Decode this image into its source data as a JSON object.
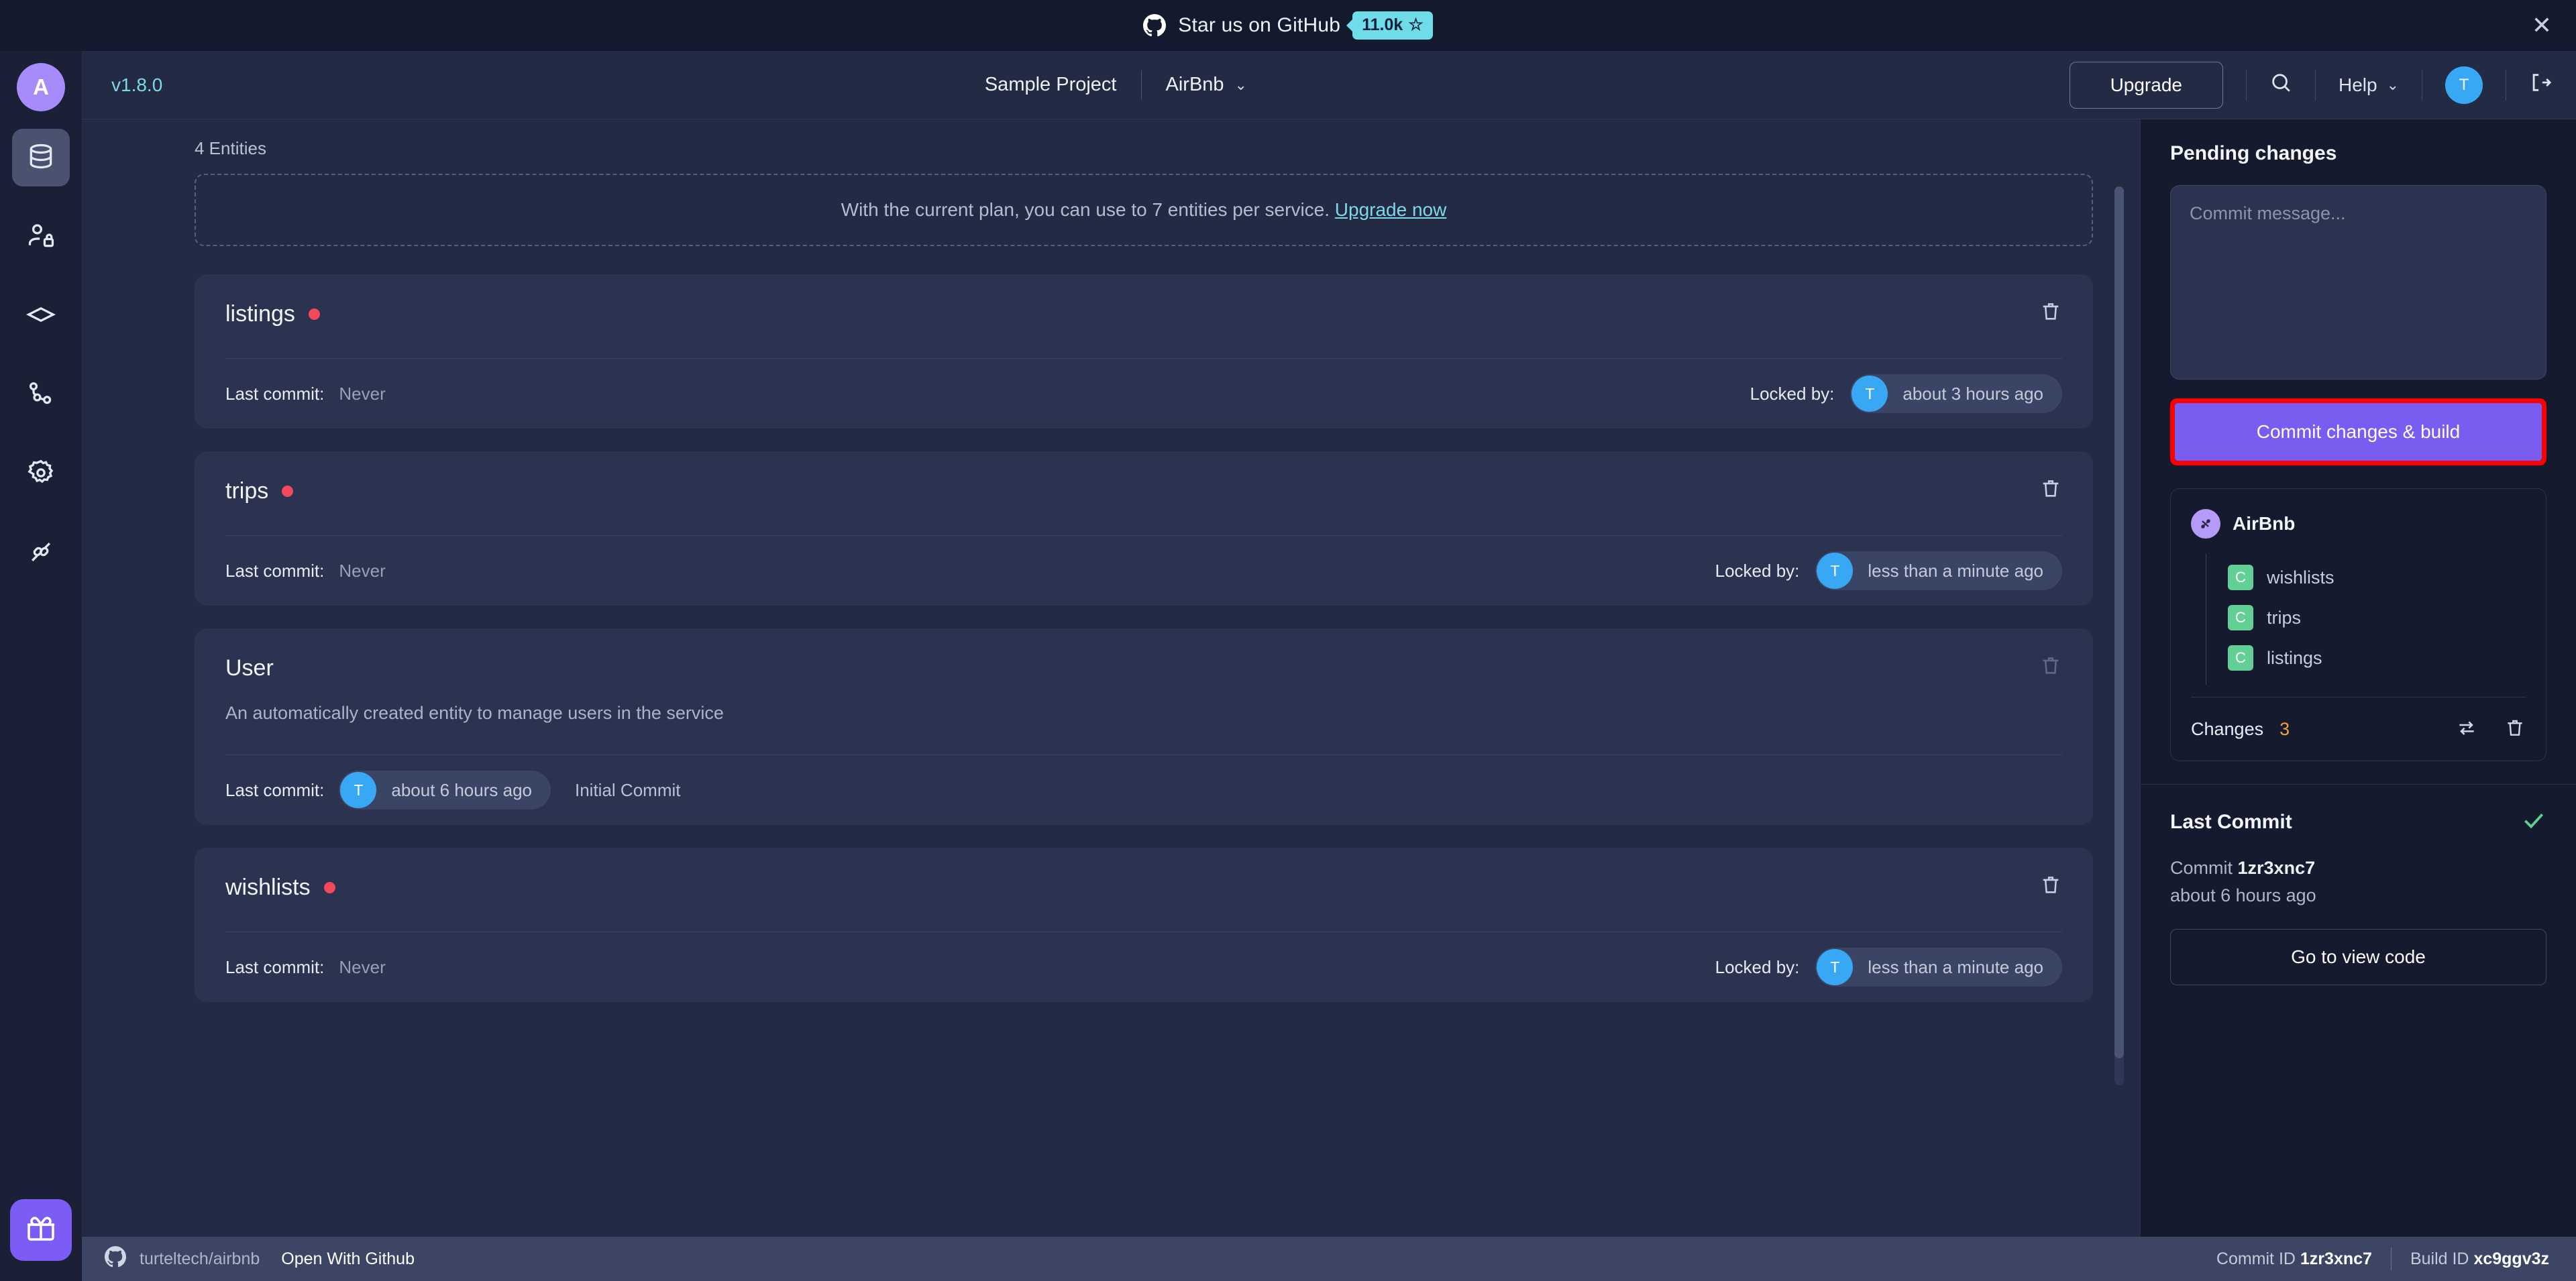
{
  "promo": {
    "icon": "github-icon",
    "text": "Star us on GitHub",
    "badge_count": "11.0k",
    "badge_star": "☆",
    "close": "✕"
  },
  "header": {
    "version": "v1.8.0",
    "project": "Sample Project",
    "service": "AirBnb",
    "service_chevron": "⌄",
    "upgrade_label": "Upgrade",
    "search_icon": "search-icon",
    "help_label": "Help",
    "help_chevron": "⌄",
    "avatar_initial": "T",
    "logout_icon": "logout-icon"
  },
  "rail": {
    "avatar_initial": "A",
    "items": [
      {
        "name": "database-icon",
        "active": true
      },
      {
        "name": "user-lock-icon",
        "active": false
      },
      {
        "name": "diamond-icon",
        "active": false
      },
      {
        "name": "git-branch-icon",
        "active": false
      },
      {
        "name": "settings-gear-icon",
        "active": false
      },
      {
        "name": "plugin-icon",
        "active": false
      }
    ],
    "gift_icon": "gift-icon"
  },
  "main": {
    "entity_count_label": "4 Entities",
    "quota_text": "With the current plan, you can use to 7 entities per service.",
    "quota_link": "Upgrade now",
    "entities": [
      {
        "name": "listings",
        "has_dot": true,
        "description": "",
        "last_commit_label": "Last commit:",
        "last_commit_value": "Never",
        "locked_label": "Locked by:",
        "locked_avatar": "T",
        "locked_time": "about 3 hours ago",
        "extra": "",
        "trash_enabled": true
      },
      {
        "name": "trips",
        "has_dot": true,
        "description": "",
        "last_commit_label": "Last commit:",
        "last_commit_value": "Never",
        "locked_label": "Locked by:",
        "locked_avatar": "T",
        "locked_time": "less than a minute ago",
        "extra": "",
        "trash_enabled": true
      },
      {
        "name": "User",
        "has_dot": false,
        "description": "An automatically created entity to manage users in the service",
        "last_commit_label": "Last commit:",
        "last_commit_value": "",
        "commit_avatar": "T",
        "commit_time": "about 6 hours ago",
        "extra": "Initial Commit",
        "locked_label": "",
        "locked_avatar": "",
        "locked_time": "",
        "trash_enabled": false
      },
      {
        "name": "wishlists",
        "has_dot": true,
        "description": "",
        "last_commit_label": "Last commit:",
        "last_commit_value": "Never",
        "locked_label": "Locked by:",
        "locked_avatar": "T",
        "locked_time": "less than a minute ago",
        "extra": "",
        "trash_enabled": true
      }
    ]
  },
  "sidepanel": {
    "pending_title": "Pending changes",
    "commit_placeholder": "Commit message...",
    "commit_button": "Commit changes & build",
    "tree_root": "AirBnb",
    "tree_items": [
      {
        "badge": "C",
        "label": "wishlists"
      },
      {
        "badge": "C",
        "label": "trips"
      },
      {
        "badge": "C",
        "label": "listings"
      }
    ],
    "changes_label": "Changes",
    "changes_count": "3",
    "compare_icon": "compare-arrows-icon",
    "discard_icon": "trash-icon",
    "last_commit_title": "Last Commit",
    "last_commit_check": "check-icon",
    "commit_prefix": "Commit",
    "commit_hash": "1zr3xnc7",
    "commit_age": "about 6 hours ago",
    "view_code_button": "Go to view code"
  },
  "status": {
    "github_icon": "github-icon",
    "repo": "turteltech/airbnb",
    "open_with": "Open With Github",
    "commit_id_label": "Commit ID",
    "commit_id": "1zr3xnc7",
    "build_id_label": "Build ID",
    "build_id": "xc9ggv3z"
  },
  "colors": {
    "accent_purple": "#7b5cf0",
    "accent_cyan": "#7fd8e8",
    "highlight_red": "#ff0000",
    "created_green": "#62d095",
    "status_orange": "#f0a33c"
  }
}
